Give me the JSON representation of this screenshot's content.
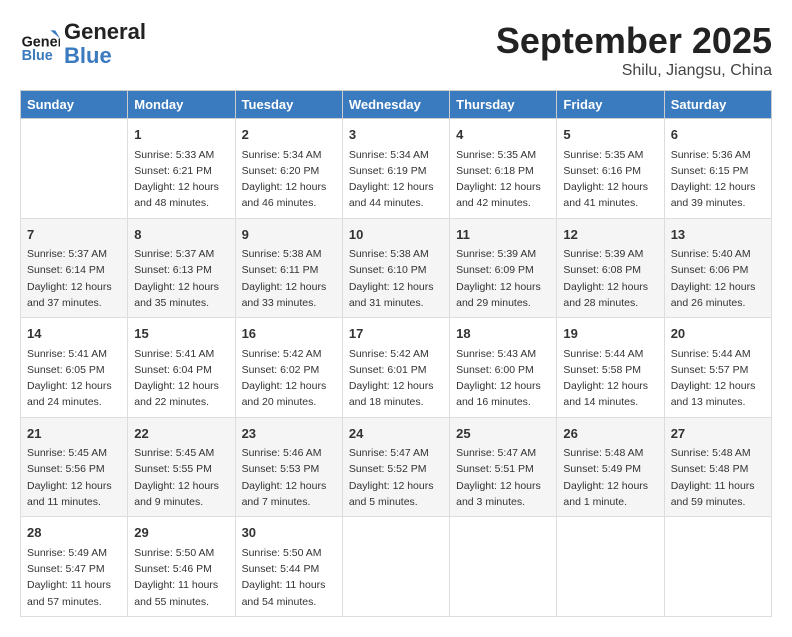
{
  "header": {
    "logo_line1": "General",
    "logo_line2": "Blue",
    "month": "September 2025",
    "location": "Shilu, Jiangsu, China"
  },
  "weekdays": [
    "Sunday",
    "Monday",
    "Tuesday",
    "Wednesday",
    "Thursday",
    "Friday",
    "Saturday"
  ],
  "weeks": [
    [
      {
        "day": "",
        "info": ""
      },
      {
        "day": "1",
        "info": "Sunrise: 5:33 AM\nSunset: 6:21 PM\nDaylight: 12 hours\nand 48 minutes."
      },
      {
        "day": "2",
        "info": "Sunrise: 5:34 AM\nSunset: 6:20 PM\nDaylight: 12 hours\nand 46 minutes."
      },
      {
        "day": "3",
        "info": "Sunrise: 5:34 AM\nSunset: 6:19 PM\nDaylight: 12 hours\nand 44 minutes."
      },
      {
        "day": "4",
        "info": "Sunrise: 5:35 AM\nSunset: 6:18 PM\nDaylight: 12 hours\nand 42 minutes."
      },
      {
        "day": "5",
        "info": "Sunrise: 5:35 AM\nSunset: 6:16 PM\nDaylight: 12 hours\nand 41 minutes."
      },
      {
        "day": "6",
        "info": "Sunrise: 5:36 AM\nSunset: 6:15 PM\nDaylight: 12 hours\nand 39 minutes."
      }
    ],
    [
      {
        "day": "7",
        "info": "Sunrise: 5:37 AM\nSunset: 6:14 PM\nDaylight: 12 hours\nand 37 minutes."
      },
      {
        "day": "8",
        "info": "Sunrise: 5:37 AM\nSunset: 6:13 PM\nDaylight: 12 hours\nand 35 minutes."
      },
      {
        "day": "9",
        "info": "Sunrise: 5:38 AM\nSunset: 6:11 PM\nDaylight: 12 hours\nand 33 minutes."
      },
      {
        "day": "10",
        "info": "Sunrise: 5:38 AM\nSunset: 6:10 PM\nDaylight: 12 hours\nand 31 minutes."
      },
      {
        "day": "11",
        "info": "Sunrise: 5:39 AM\nSunset: 6:09 PM\nDaylight: 12 hours\nand 29 minutes."
      },
      {
        "day": "12",
        "info": "Sunrise: 5:39 AM\nSunset: 6:08 PM\nDaylight: 12 hours\nand 28 minutes."
      },
      {
        "day": "13",
        "info": "Sunrise: 5:40 AM\nSunset: 6:06 PM\nDaylight: 12 hours\nand 26 minutes."
      }
    ],
    [
      {
        "day": "14",
        "info": "Sunrise: 5:41 AM\nSunset: 6:05 PM\nDaylight: 12 hours\nand 24 minutes."
      },
      {
        "day": "15",
        "info": "Sunrise: 5:41 AM\nSunset: 6:04 PM\nDaylight: 12 hours\nand 22 minutes."
      },
      {
        "day": "16",
        "info": "Sunrise: 5:42 AM\nSunset: 6:02 PM\nDaylight: 12 hours\nand 20 minutes."
      },
      {
        "day": "17",
        "info": "Sunrise: 5:42 AM\nSunset: 6:01 PM\nDaylight: 12 hours\nand 18 minutes."
      },
      {
        "day": "18",
        "info": "Sunrise: 5:43 AM\nSunset: 6:00 PM\nDaylight: 12 hours\nand 16 minutes."
      },
      {
        "day": "19",
        "info": "Sunrise: 5:44 AM\nSunset: 5:58 PM\nDaylight: 12 hours\nand 14 minutes."
      },
      {
        "day": "20",
        "info": "Sunrise: 5:44 AM\nSunset: 5:57 PM\nDaylight: 12 hours\nand 13 minutes."
      }
    ],
    [
      {
        "day": "21",
        "info": "Sunrise: 5:45 AM\nSunset: 5:56 PM\nDaylight: 12 hours\nand 11 minutes."
      },
      {
        "day": "22",
        "info": "Sunrise: 5:45 AM\nSunset: 5:55 PM\nDaylight: 12 hours\nand 9 minutes."
      },
      {
        "day": "23",
        "info": "Sunrise: 5:46 AM\nSunset: 5:53 PM\nDaylight: 12 hours\nand 7 minutes."
      },
      {
        "day": "24",
        "info": "Sunrise: 5:47 AM\nSunset: 5:52 PM\nDaylight: 12 hours\nand 5 minutes."
      },
      {
        "day": "25",
        "info": "Sunrise: 5:47 AM\nSunset: 5:51 PM\nDaylight: 12 hours\nand 3 minutes."
      },
      {
        "day": "26",
        "info": "Sunrise: 5:48 AM\nSunset: 5:49 PM\nDaylight: 12 hours\nand 1 minute."
      },
      {
        "day": "27",
        "info": "Sunrise: 5:48 AM\nSunset: 5:48 PM\nDaylight: 11 hours\nand 59 minutes."
      }
    ],
    [
      {
        "day": "28",
        "info": "Sunrise: 5:49 AM\nSunset: 5:47 PM\nDaylight: 11 hours\nand 57 minutes."
      },
      {
        "day": "29",
        "info": "Sunrise: 5:50 AM\nSunset: 5:46 PM\nDaylight: 11 hours\nand 55 minutes."
      },
      {
        "day": "30",
        "info": "Sunrise: 5:50 AM\nSunset: 5:44 PM\nDaylight: 11 hours\nand 54 minutes."
      },
      {
        "day": "",
        "info": ""
      },
      {
        "day": "",
        "info": ""
      },
      {
        "day": "",
        "info": ""
      },
      {
        "day": "",
        "info": ""
      }
    ]
  ]
}
